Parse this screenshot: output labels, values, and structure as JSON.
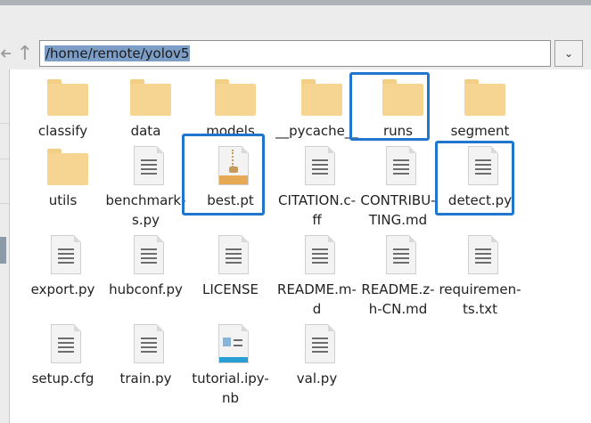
{
  "address_bar": {
    "path": "/home/remote/yolov5"
  },
  "nav": {
    "back_icon": "back-arrow-icon",
    "up_icon": "up-arrow-icon",
    "dropdown_icon": "chevron-down-icon"
  },
  "files": [
    {
      "name": "classify",
      "icon": "folder"
    },
    {
      "name": "data",
      "icon": "folder"
    },
    {
      "name": "models",
      "icon": "folder"
    },
    {
      "name": "__pycache__",
      "icon": "folder"
    },
    {
      "name": "runs",
      "icon": "folder",
      "highlighted": true
    },
    {
      "name": "segment",
      "icon": "folder"
    },
    {
      "name": "utils",
      "icon": "folder"
    },
    {
      "name": "benchmark-s.py",
      "icon": "text-file"
    },
    {
      "name": "best.pt",
      "icon": "archive-file",
      "highlighted": true
    },
    {
      "name": "CITATION.c-ff",
      "icon": "text-file"
    },
    {
      "name": "CONTRIBU-TING.md",
      "icon": "text-file"
    },
    {
      "name": "detect.py",
      "icon": "text-file",
      "highlighted": true
    },
    {
      "name": "export.py",
      "icon": "text-file"
    },
    {
      "name": "hubconf.py",
      "icon": "text-file"
    },
    {
      "name": "LICENSE",
      "icon": "text-file"
    },
    {
      "name": "README.m-d",
      "icon": "text-file"
    },
    {
      "name": "README.z-h-CN.md",
      "icon": "text-file"
    },
    {
      "name": "requiremen-ts.txt",
      "icon": "text-file"
    },
    {
      "name": "setup.cfg",
      "icon": "text-file"
    },
    {
      "name": "train.py",
      "icon": "text-file"
    },
    {
      "name": "tutorial.ipy-nb",
      "icon": "notebook-file"
    },
    {
      "name": "val.py",
      "icon": "text-file"
    }
  ],
  "colors": {
    "highlight": "#1f76cc",
    "folder": "#f6d592",
    "selection": "#7d9ec6"
  }
}
